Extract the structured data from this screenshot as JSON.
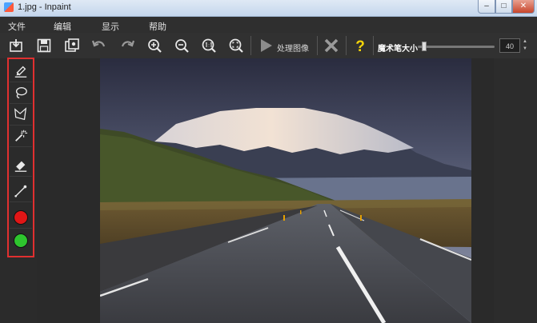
{
  "window": {
    "title": "1.jpg - Inpaint",
    "buttons": {
      "minimize": "–",
      "maximize": "□",
      "close": "✕"
    }
  },
  "menu": {
    "items": [
      "文件",
      "编辑",
      "显示",
      "帮助"
    ]
  },
  "toolbar": {
    "process_label": "处理图像",
    "brush_size_label": "魔术笔大小",
    "brush_size_value": "40",
    "brush_size_fraction": 0.05,
    "icons": [
      "open-icon",
      "save-icon",
      "save-as-icon",
      "undo-icon",
      "redo-icon",
      "zoom-in-icon",
      "zoom-out-icon",
      "zoom-actual-icon",
      "zoom-fit-icon",
      "play-icon",
      "clear-icon",
      "help-icon"
    ]
  },
  "tools": {
    "icons": [
      "marker-icon",
      "lasso-icon",
      "polygon-lasso-icon",
      "magic-wand-icon",
      "eraser-icon",
      "line-icon"
    ],
    "colors": {
      "red": "#e01616",
      "green": "#2ec52e"
    }
  },
  "colors": {
    "highlight_frame": "#e03030",
    "help_yellow": "#f5d50a"
  }
}
